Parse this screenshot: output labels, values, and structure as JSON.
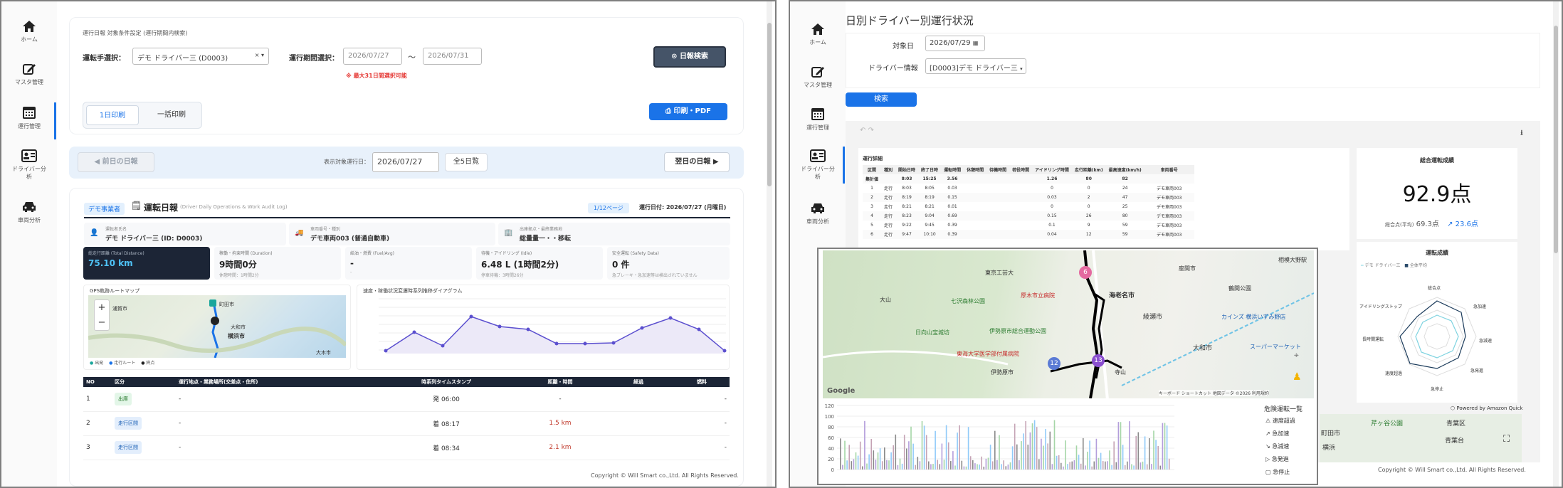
{
  "nav": [
    {
      "key": "home",
      "label": "ホーム",
      "icon": "home-icon"
    },
    {
      "key": "master",
      "label": "マスタ管理",
      "icon": "edit-icon"
    },
    {
      "key": "operation",
      "label": "運行管理",
      "icon": "calendar-icon"
    },
    {
      "key": "driver",
      "label": "ドライバー分析",
      "icon": "id-card-icon"
    },
    {
      "key": "vehicle",
      "label": "車両分析",
      "icon": "car-icon"
    }
  ],
  "left": {
    "filter_title": "運行日報 対象条件設定 (運行期間内検索)",
    "driver_label": "運転手選択：",
    "driver_value": "デモ ドライバー三 (D0003)",
    "period_label": "運行期間選択：",
    "date_from": "2026/07/27",
    "date_to": "2026/07/31",
    "tilde": "〜",
    "period_note": "※ 最大31日間選択可能",
    "search_button": "日報検索",
    "tab_single": "1日印刷",
    "tab_bulk": "一括印刷",
    "print_button": "印刷・PDF",
    "prev_button": "前日の日報",
    "next_button": "翌日の日報",
    "date_label": "表示対象運行日：",
    "date_value": "2026/07/27",
    "all_days_button": "全5日覧",
    "report": {
      "company_badge": "デモ事業者",
      "title": "運転日報",
      "subtitle": "(Driver Daily Operations & Work Audit Log)",
      "page_badge": "1/12ページ",
      "op_date": "運行日付: 2026/07/27 (月曜日)",
      "driver_caption": "運転者氏名",
      "driver_name": "デモ ドライバー三 (ID: D0003)",
      "vehicle_caption": "車両番号・種別",
      "vehicle_name": "デモ車両003 (普通自動車)",
      "base_caption": "出庫拠点・最終業務地",
      "base_name": "総量量一・・移転",
      "kpis": [
        {
          "title": "総走行距離 (Total Distance)",
          "value": "75.10 km",
          "sub": ""
        },
        {
          "title": "稼働・拘束時間 (Duration)",
          "value": "9時間0分",
          "sub": "休憩時間：1時間2分"
        },
        {
          "title": "給油・燃費 (Fuel/Avg)",
          "value": "-",
          "sub": "-"
        },
        {
          "title": "待機・アイドリング (Idle)",
          "value": "6.48 L (1時間2分)",
          "sub": "停車待機：3時間26分"
        },
        {
          "title": "安全運転 (Safety Data)",
          "value": "0 件",
          "sub": "急ブレーキ・急加速等は検出されていません"
        }
      ],
      "map_title": "GPS軌跡ルートマップ",
      "map_legend": [
        "出発",
        "走行ルート",
        "終点"
      ],
      "map_places": [
        "浦賀市",
        "大和市",
        "横浜市",
        "町田市",
        "大木市"
      ],
      "speed_title": "速度・稼働状況変遷時系列推移ダイアグラム",
      "list_headers": [
        "NO",
        "区分",
        "運行地点・業務場所(交差点・住所)",
        "時系列タイムスタンプ",
        "距離・時間",
        "経過",
        "燃料"
      ],
      "list_rows": [
        {
          "no": "1",
          "type": "出庫",
          "place": "-",
          "time": "発 06:00",
          "dist": "-",
          "fuel": "-"
        },
        {
          "no": "2",
          "type": "走行区間",
          "place": "-",
          "time": "着 08:17",
          "dist": "1.5 km",
          "fuel": "-"
        },
        {
          "no": "3",
          "type": "走行区間",
          "place": "-",
          "time": "着 08:34",
          "dist": "2.1 km",
          "fuel": "-"
        }
      ]
    },
    "copyright": "Copyright © Will Smart co.,Ltd. All Rights Reserved."
  },
  "right": {
    "page_title": "日別ドライバー別運行状況",
    "target_date_label": "対象日",
    "target_date": "2026/07/29",
    "driver_info_label": "ドライバー情報",
    "driver_info_value": "[D0003]デモ ドライバー三",
    "search_button": "検索",
    "detail_title": "運行詳細",
    "detail_headers": [
      "区間",
      "種別",
      "開始日時",
      "終了日時",
      "運転時間",
      "休憩時間",
      "待機時間",
      "荷役時間",
      "アイドリング時間",
      "走行距離(km)",
      "最高速度(km/h)",
      "車両番号"
    ],
    "detail_total": [
      "集計値",
      "",
      "8:03",
      "15:25",
      "3.56",
      "",
      "",
      "",
      "1.26",
      "80",
      "82",
      ""
    ],
    "detail_rows": [
      [
        "1",
        "走行",
        "8:03",
        "8:05",
        "0.03",
        "",
        "",
        "",
        "0",
        "0",
        "24",
        "デモ車両003"
      ],
      [
        "2",
        "走行",
        "8:19",
        "8:19",
        "0.15",
        "",
        "",
        "",
        "0.03",
        "2",
        "47",
        "デモ車両003"
      ],
      [
        "3",
        "走行",
        "8:21",
        "8:21",
        "0.01",
        "",
        "",
        "",
        "0",
        "0",
        "25",
        "デモ車両003"
      ],
      [
        "4",
        "走行",
        "8:23",
        "9:04",
        "0.69",
        "",
        "",
        "",
        "0.15",
        "26",
        "80",
        "デモ車両003"
      ],
      [
        "5",
        "走行",
        "9:22",
        "9:45",
        "0.39",
        "",
        "",
        "",
        "0.1",
        "9",
        "59",
        "デモ車両003"
      ],
      [
        "6",
        "走行",
        "9:47",
        "10:10",
        "0.39",
        "",
        "",
        "",
        "0.04",
        "12",
        "59",
        "デモ車両003"
      ]
    ],
    "score_title": "総合運転成績",
    "score_value": "92.9点",
    "score_avg_label": "総合点(平均)",
    "score_avg": "69.3点",
    "score_diff": "↗ 23.6点",
    "radar_title": "運転成績",
    "radar_legend": [
      "デモ ドライバー三",
      "全体平均"
    ],
    "radar_axes": [
      "総合点",
      "急加速",
      "急減速",
      "急発進",
      "急停止",
      "速度超過",
      "長時間運転",
      "アイドリングストップ"
    ],
    "map_places": [
      "東京工芸大",
      "厚木市立病院",
      "相模大野駅",
      "七沢森林公園",
      "日向山宝城坊",
      "伊勢原市総合運動公園",
      "東海大学医学部付属病院",
      "伊勢原市",
      "カインズ 横浜いずみ野店",
      "スーパーマーケット",
      "鶴間公園",
      "座間市",
      "海老名市",
      "綾瀬市",
      "大和市",
      "大山",
      "寺山"
    ],
    "map_badges": [
      "6",
      "12",
      "13"
    ],
    "map_footer": "キーボード ショートカット  地図データ ©2026  利用規約",
    "amazon_credit": "Powered by Amazon Quick",
    "hazard_title": "危険運転一覧",
    "hazard_items": [
      "速度超過",
      "急加速",
      "急減速",
      "急発進",
      "急停止"
    ],
    "bar_y_ticks": [
      "120",
      "100",
      "80",
      "60",
      "40",
      "20",
      "0"
    ],
    "mini_map_labels": [
      "芹ヶ谷公園",
      "青葉区",
      "町田市",
      "横浜",
      "青葉台"
    ],
    "copyright": "Copyright © Will Smart co.,Ltd. All Rights Reserved."
  },
  "colors": {
    "primary": "#1a73e8",
    "dark": "#1c2536",
    "teal": "#1aa6a1",
    "purple": "#6a5acd"
  }
}
